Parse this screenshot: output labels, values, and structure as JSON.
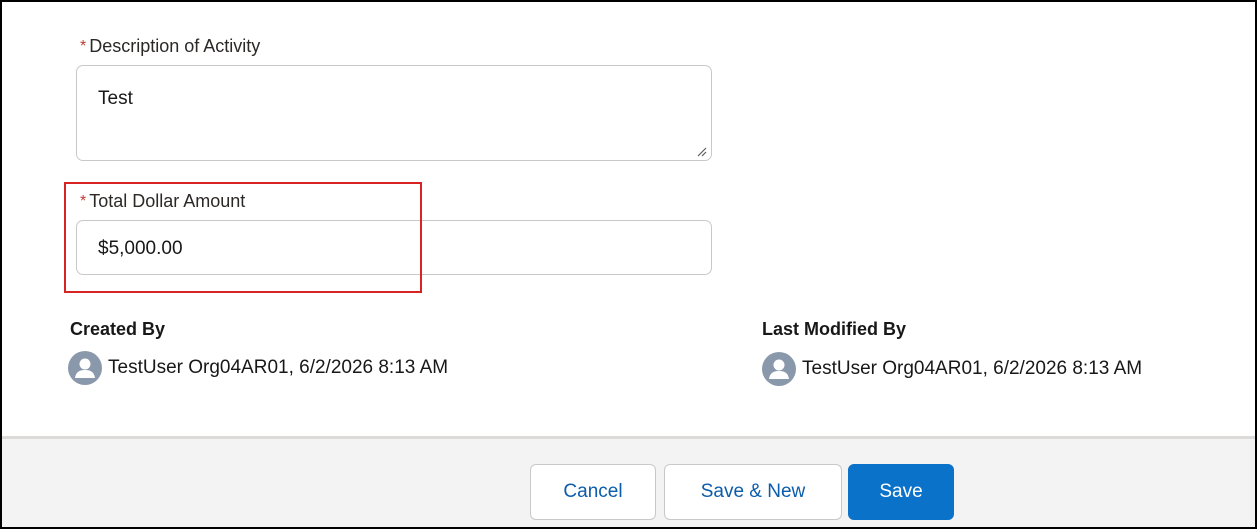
{
  "form": {
    "description": {
      "required_marker": "*",
      "label": "Description of Activity",
      "value": "Test"
    },
    "total_amount": {
      "required_marker": "*",
      "label": "Total Dollar Amount",
      "value": "$5,000.00"
    },
    "created_by": {
      "label": "Created By",
      "value": "TestUser Org04AR01, 6/2/2026 8:13 AM",
      "icon": "user-avatar-icon"
    },
    "last_modified_by": {
      "label": "Last Modified By",
      "value": "TestUser Org04AR01, 6/2/2026 8:13 AM",
      "icon": "user-avatar-icon"
    }
  },
  "footer": {
    "cancel_label": "Cancel",
    "save_new_label": "Save & New",
    "save_label": "Save"
  },
  "colors": {
    "required": "#c23934",
    "highlight": "#d62424",
    "brand": "#0b72c9",
    "link": "#0b5cab"
  }
}
